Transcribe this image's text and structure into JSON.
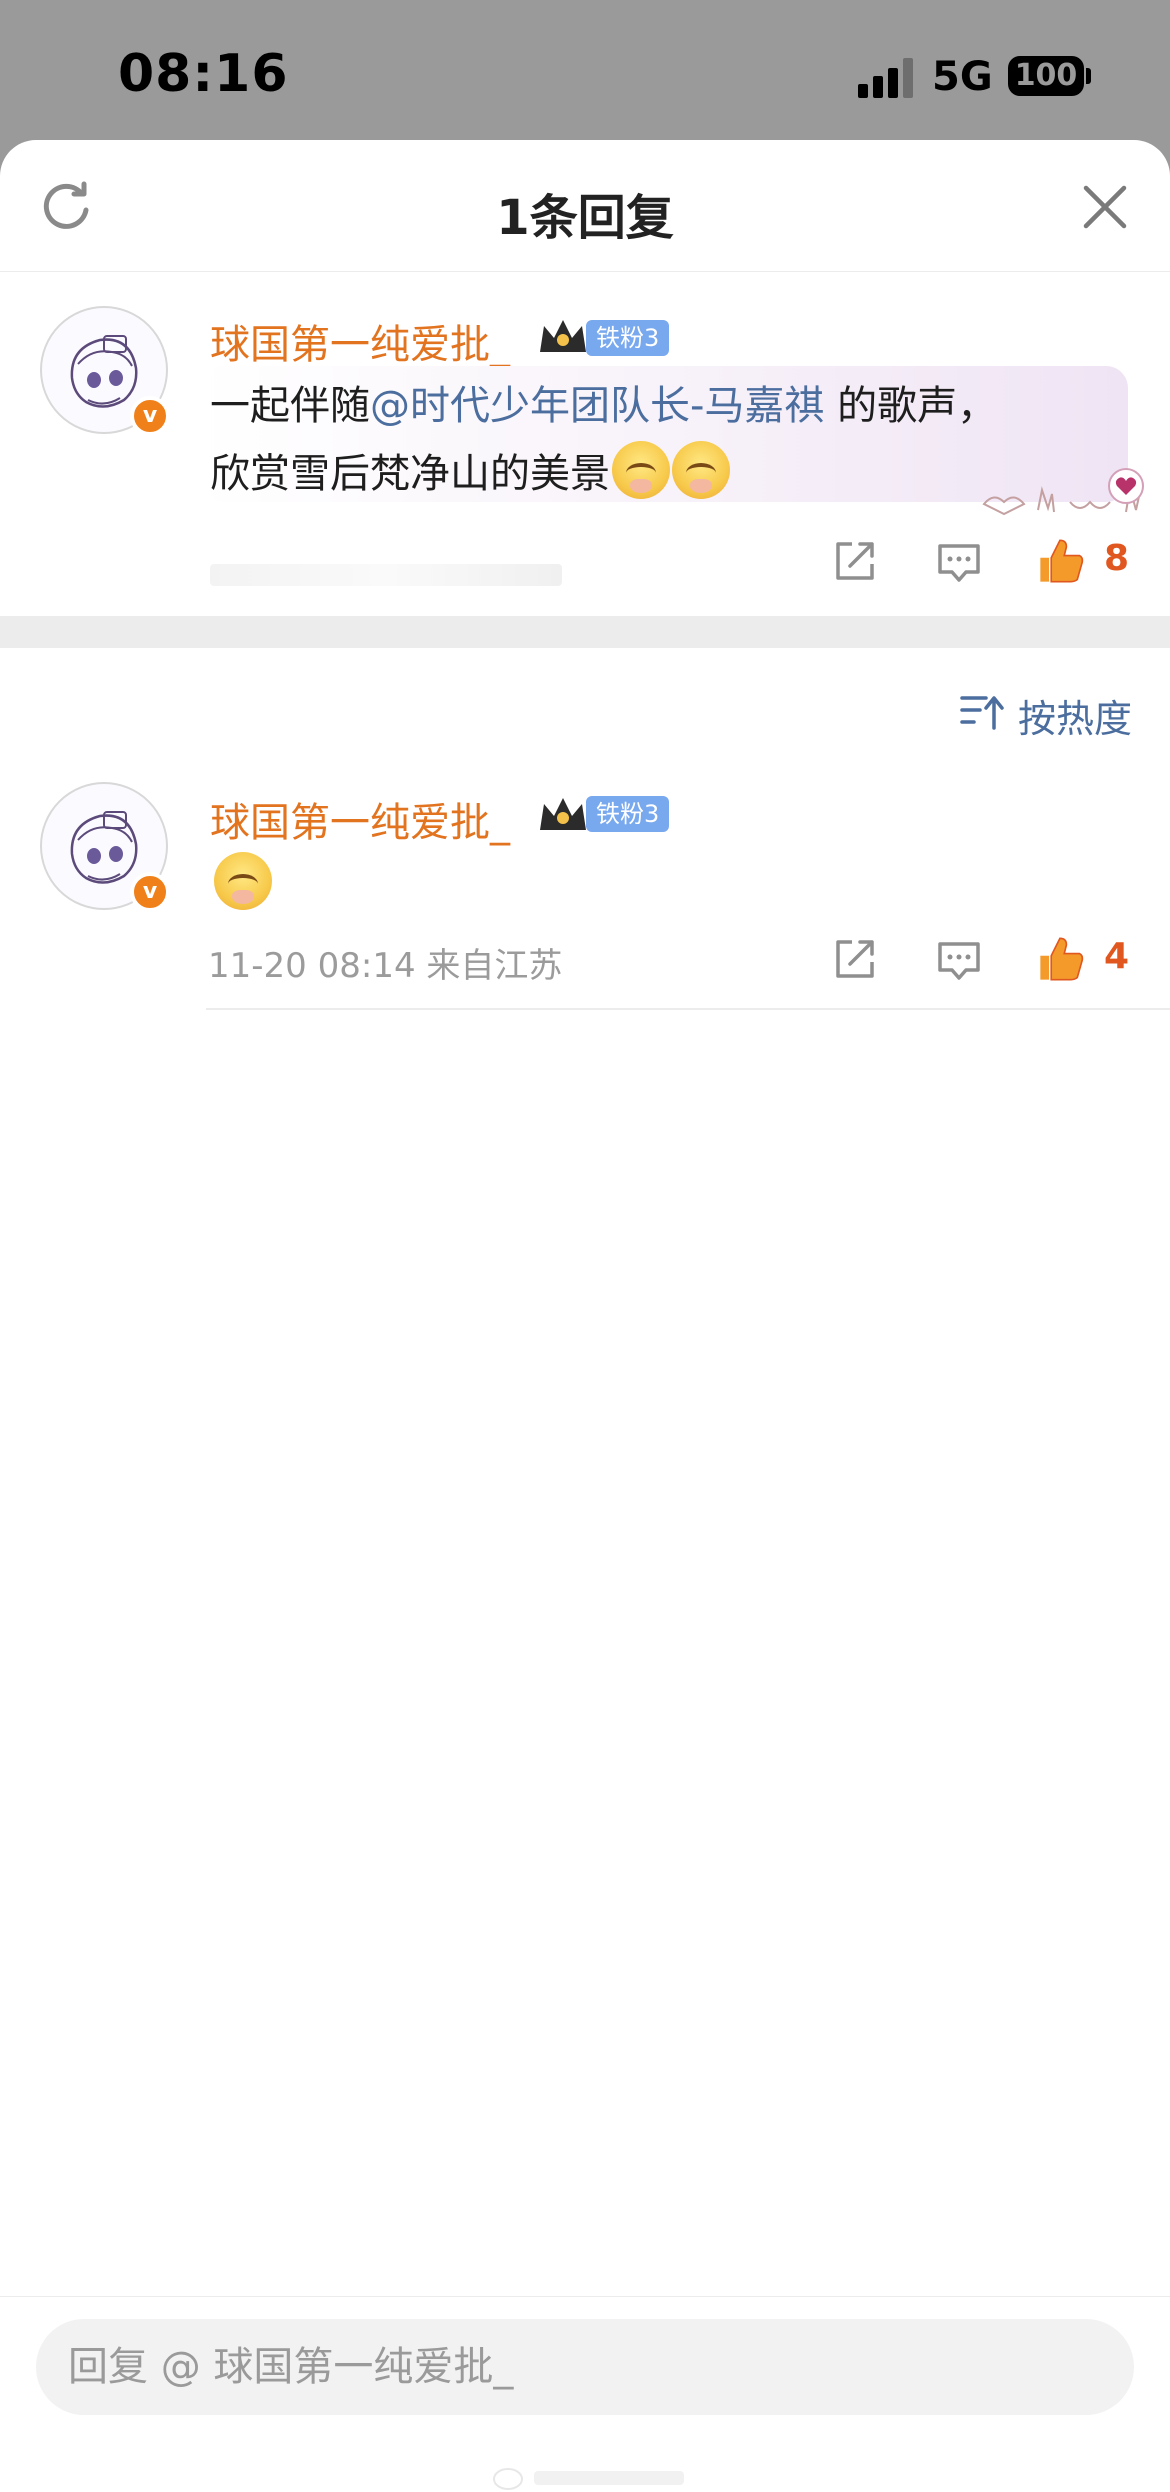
{
  "status_bar": {
    "time": "08:16",
    "network": "5G",
    "battery": "100"
  },
  "header": {
    "title": "1条回复"
  },
  "root_comment": {
    "username": "球国第一纯爱批_",
    "fan_badge": "铁粉3",
    "text_prefix": "一起伴随",
    "mention": "@时代少年团队长-马嘉祺",
    "text_suffix": " 的歌声，",
    "text_line2": "欣赏雪后梵净山的美景",
    "like_count": "8"
  },
  "sort": {
    "label": "按热度"
  },
  "reply": {
    "username": "球国第一纯爱批_",
    "fan_badge": "铁粉3",
    "timestamp": "11-20 08:14",
    "location": "来自江苏",
    "like_count": "4"
  },
  "reply_input": {
    "placeholder": "回复 @ 球国第一纯爱批_"
  },
  "colors": {
    "username": "#e2731f",
    "mention": "#4b6e9f",
    "like": "#e0571f",
    "fan_badge": "#78a8ee",
    "verified_badge": "#f0801a"
  }
}
